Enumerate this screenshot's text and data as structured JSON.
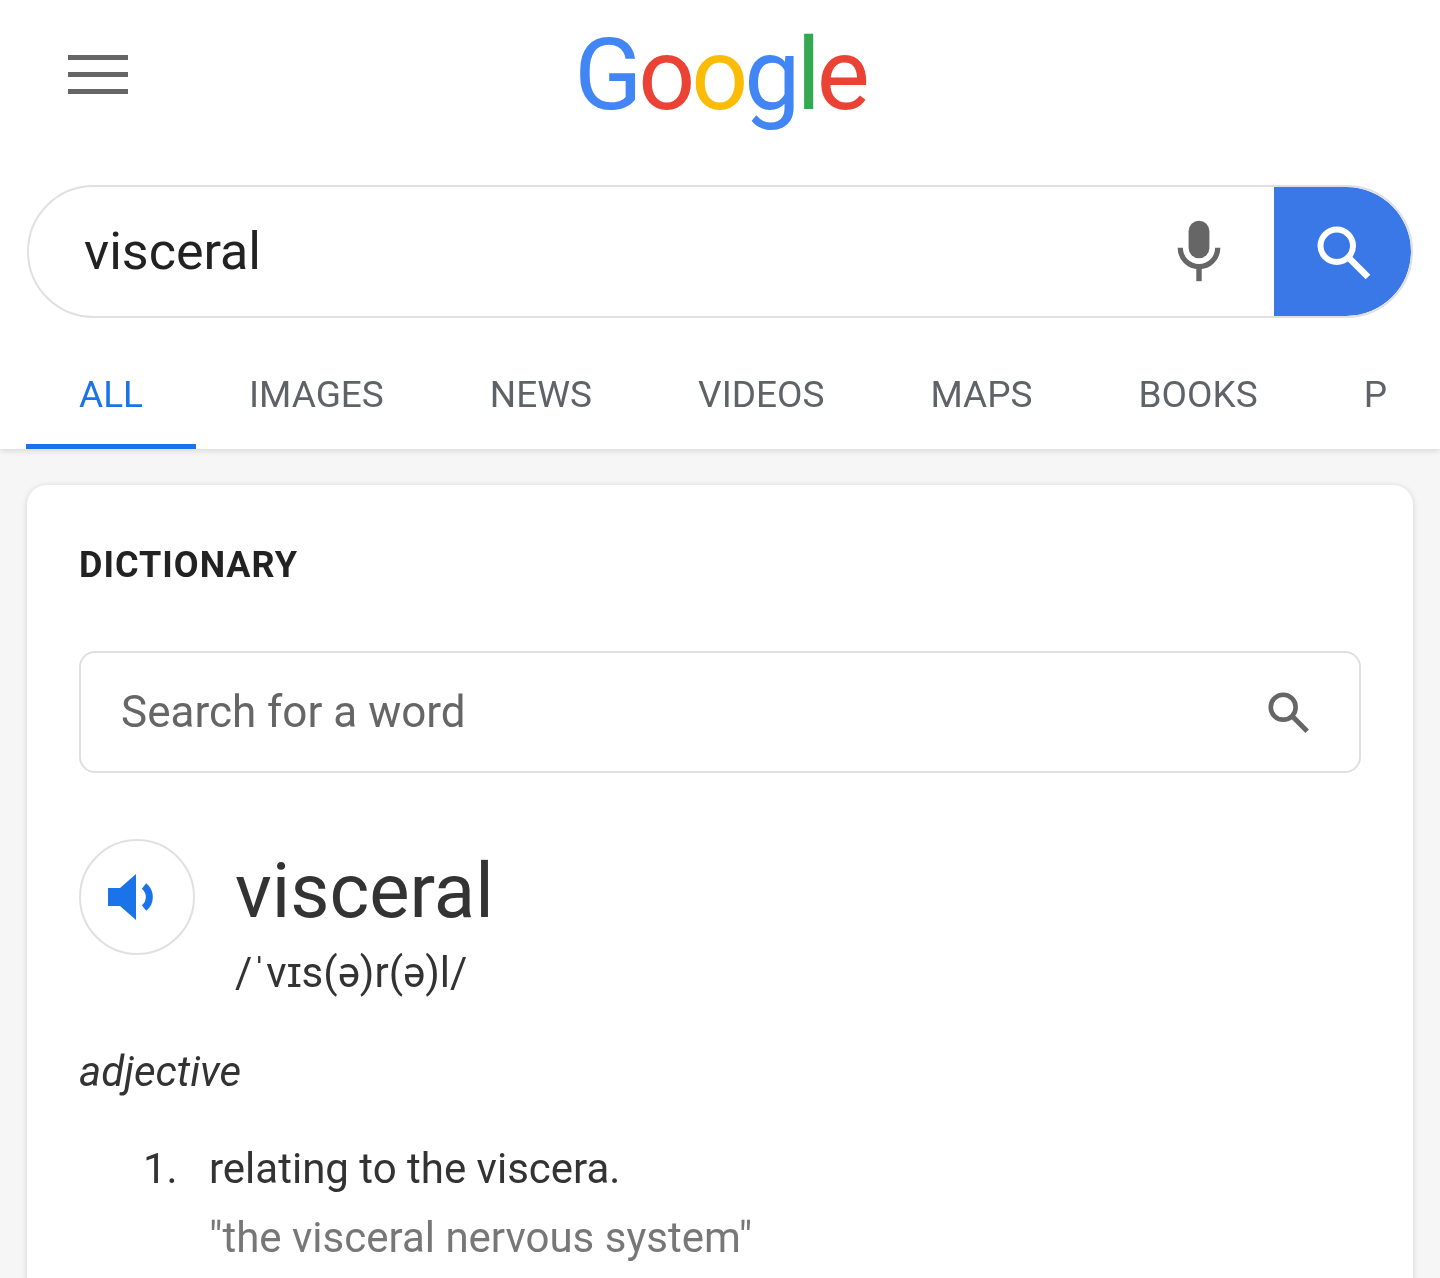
{
  "logo": {
    "letters": [
      {
        "char": "G",
        "color": "#4285f4"
      },
      {
        "char": "o",
        "color": "#ea4335"
      },
      {
        "char": "o",
        "color": "#fbbc05"
      },
      {
        "char": "g",
        "color": "#4285f4"
      },
      {
        "char": "l",
        "color": "#34a853"
      },
      {
        "char": "e",
        "color": "#ea4335"
      }
    ]
  },
  "search": {
    "value": "visceral"
  },
  "tabs": [
    {
      "label": "ALL",
      "selected": true
    },
    {
      "label": "IMAGES",
      "selected": false
    },
    {
      "label": "NEWS",
      "selected": false
    },
    {
      "label": "VIDEOS",
      "selected": false
    },
    {
      "label": "MAPS",
      "selected": false
    },
    {
      "label": "BOOKS",
      "selected": false
    },
    {
      "label": "P",
      "selected": false
    }
  ],
  "dictionary": {
    "heading": "DICTIONARY",
    "search_placeholder": "Search for a word",
    "word": "visceral",
    "pronunciation": "/ˈvɪs(ə)r(ə)l/",
    "part_of_speech": "adjective",
    "definitions": [
      {
        "number": "1.",
        "text": "relating to the viscera.",
        "example": "\"the visceral nervous system\""
      }
    ]
  }
}
